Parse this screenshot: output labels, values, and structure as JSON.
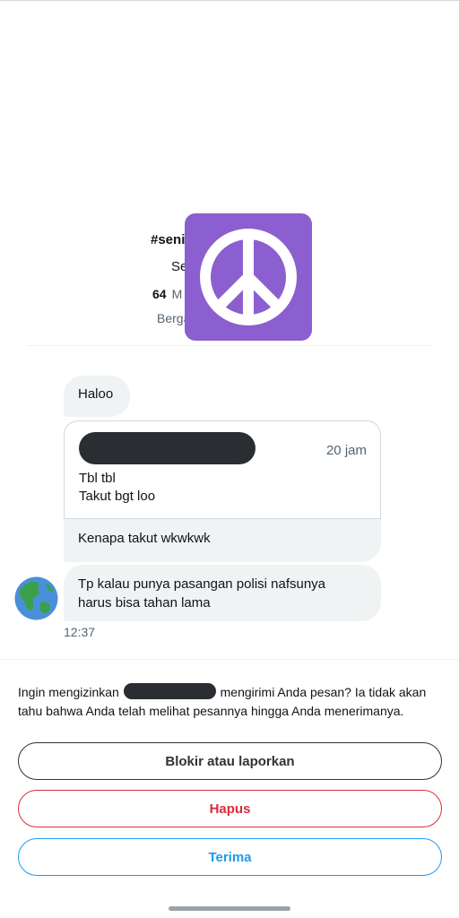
{
  "profile": {
    "name": "#seni",
    "line2": "Se",
    "stats_count": "64",
    "stats_label": "M",
    "joined": "Berga",
    "avatar_icon": "peace-sign-icon",
    "avatar_color": "#8b5fcf"
  },
  "messages": {
    "haloo": "Haloo",
    "quote": {
      "time": "20 jam",
      "line1": "Tbl tbl",
      "line2": "Takut bgt loo"
    },
    "kenapa": "Kenapa takut wkwkwk",
    "tp_line1": "Tp kalau punya pasangan polisi nafsunya",
    "tp_line2": "harus bisa tahan lama",
    "time": "12:37",
    "sender_avatar_icon": "globe-americas-icon"
  },
  "request": {
    "text_before": "Ingin mengizinkan ",
    "text_after": " mengirimi Anda pesan? Ia tidak akan tahu bahwa Anda telah melihat pesannya hingga Anda menerimanya."
  },
  "buttons": {
    "block": "Blokir atau laporkan",
    "delete": "Hapus",
    "accept": "Terima"
  },
  "colors": {
    "danger": "#d92d3a",
    "accent": "#1d9bf0"
  }
}
